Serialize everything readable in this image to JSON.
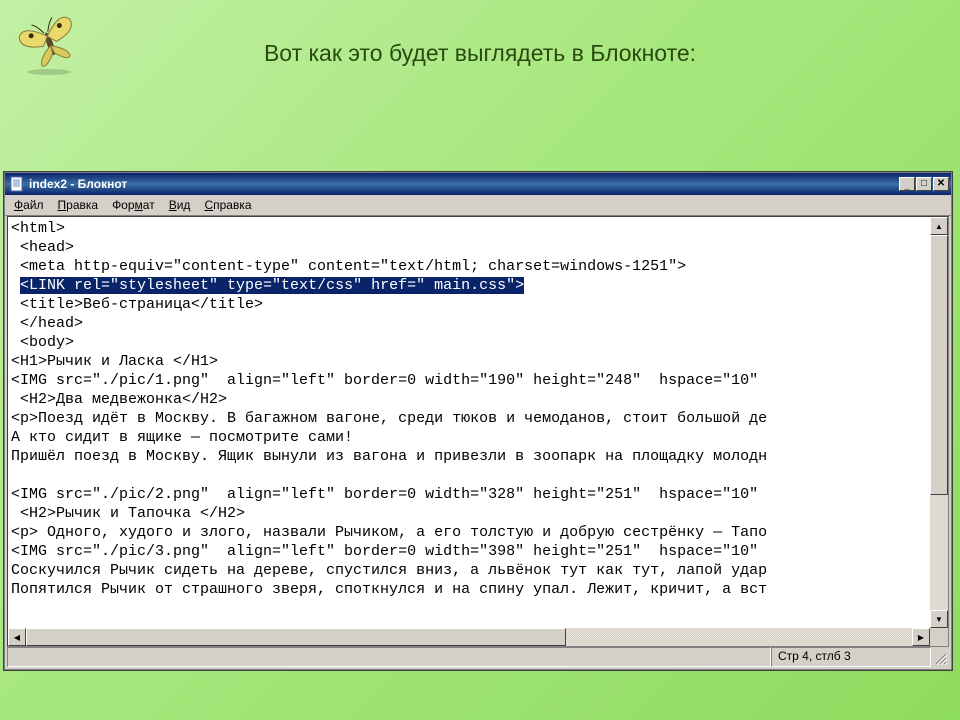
{
  "slide": {
    "title": "Вот как это будет выглядеть в Блокноте:"
  },
  "window": {
    "title": "index2 - Блокнот",
    "min_label": "_",
    "max_label": "□",
    "close_label": "✕"
  },
  "menubar": {
    "file": {
      "u": "Ф",
      "rest": "айл"
    },
    "edit": {
      "u": "П",
      "rest": "равка"
    },
    "format": {
      "u": "",
      "rest": "Фор",
      "u2": "м",
      "rest2": "ат"
    },
    "view": {
      "u": "В",
      "rest": "ид"
    },
    "help": {
      "u": "С",
      "rest": "правка"
    }
  },
  "editor": {
    "lines_before_sel": "<html>\n <head>\n <meta http-equiv=\"content-type\" content=\"text/html; charset=windows-1251\">\n ",
    "selected": "<LINK rel=\"stylesheet\" type=\"text/css\" href=\" main.css\">",
    "lines_after_sel": "\n <title>Веб-страница</title>\n </head>\n <body>\n<H1>Рычик и Ласка </H1>\n<IMG src=\"./pic/1.png\"  align=\"left\" border=0 width=\"190\" height=\"248\"  hspace=\"10\"\n <H2>Два медвежонка</H2>\n<p>Поезд идёт в Москву. В багажном вагоне, среди тюков и чемоданов, стоит большой де\nА кто сидит в ящике — посмотрите сами!\nПришёл поезд в Москву. Ящик вынули из вагона и привезли в зоопарк на площадку молодн\n\n<IMG src=\"./pic/2.png\"  align=\"left\" border=0 width=\"328\" height=\"251\"  hspace=\"10\"\n <H2>Рычик и Тапочка </H2>\n<p> Одного, худого и злого, назвали Рычиком, а его толстую и добрую сестрёнку — Тапо\n<IMG src=\"./pic/3.png\"  align=\"left\" border=0 width=\"398\" height=\"251\"  hspace=\"10\"\nСоскучился Рычик сидеть на дереве, спустился вниз, а львёнок тут как тут, лапой удар\nПопятился Рычик от страшного зверя, споткнулся и на спину упал. Лежит, кричит, а вст"
  },
  "status": {
    "pos": "Стр 4, стлб 3"
  },
  "scroll": {
    "up": "▲",
    "down": "▼",
    "left": "◀",
    "right": "▶"
  }
}
